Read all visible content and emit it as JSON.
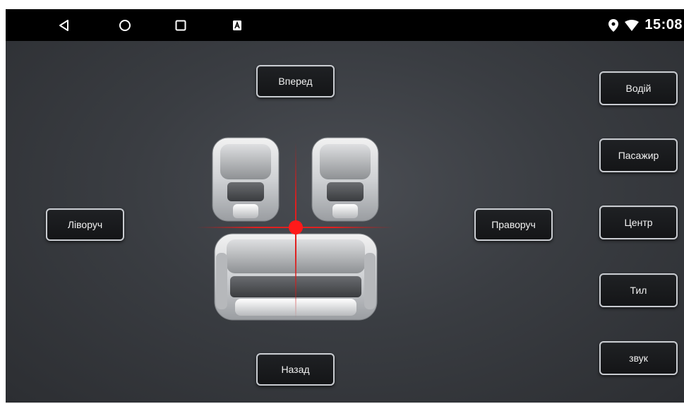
{
  "status_bar": {
    "nav_icons": [
      "back-triangle-icon",
      "home-circle-icon",
      "recents-square-icon",
      "notification-app-icon"
    ],
    "status_icons": [
      "location-pin-icon",
      "wifi-icon"
    ],
    "time": "15:08"
  },
  "balance": {
    "forward_label": "Вперед",
    "back_label": "Назад",
    "left_label": "Ліворуч",
    "right_label": "Праворуч",
    "marker_color": "#ff1a1a",
    "crosshair_color": "#e02020"
  },
  "presets": {
    "driver_label": "Водій",
    "passenger_label": "Пасажир",
    "center_label": "Центр",
    "rear_label": "Тил",
    "sound_label": "звук"
  }
}
